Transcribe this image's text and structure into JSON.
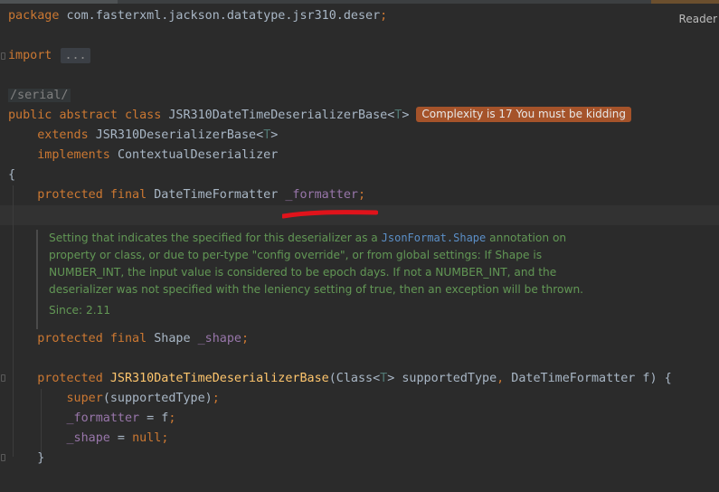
{
  "toolbar": {
    "reader_label": "Reader"
  },
  "code": {
    "package_kw": "package",
    "package_name": "com.fasterxml.jackson.datatype.jsr310.deser",
    "semicolon": ";",
    "import_kw": "import",
    "import_fold": "...",
    "annotation": "/serial/",
    "class_public": "public",
    "class_abstract": "abstract",
    "class_kw": "class",
    "class_name": "JSR310DateTimeDeserializerBase",
    "type_param_open": "<",
    "type_param": "T",
    "type_param_close": ">",
    "complexity_hint": "Complexity is 17 You must be kidding",
    "extends_kw": "extends",
    "extends_name": "JSR310DeserializerBase",
    "implements_kw": "implements",
    "implements_name": "ContextualDeserializer",
    "open_brace": "{",
    "close_brace": "}",
    "field1_mods": "protected final",
    "field1_type": "DateTimeFormatter",
    "field1_name": "_formatter",
    "doc_text_1": "Setting that indicates the specified for this deserializer as a",
    "doc_link": "JsonFormat.Shape",
    "doc_text_2": "annotation on property or class, or due to per-type \"config override\", or from global settings: If Shape is NUMBER_INT, the input value is considered to be epoch days. If not a NUMBER_INT, and the deserializer was not specified with the leniency setting of true, then an exception will be thrown.",
    "doc_since": "Since: 2.11",
    "field2_mods": "protected final",
    "field2_type": "Shape",
    "field2_name": "_shape",
    "ctor_mod": "protected",
    "ctor_name": "JSR310DateTimeDeserializerBase",
    "ctor_params_1": "(Class<",
    "ctor_params_T": "T",
    "ctor_params_2": "> supportedType",
    "ctor_comma": ",",
    "ctor_params_3": " DateTimeFormatter f) {",
    "super_kw": "super",
    "super_args": "(supportedType)",
    "assign1_name": "_formatter",
    "assign1_rest": " = f",
    "assign2_name": "_shape",
    "assign2_eq": " = ",
    "null_kw": "null"
  }
}
